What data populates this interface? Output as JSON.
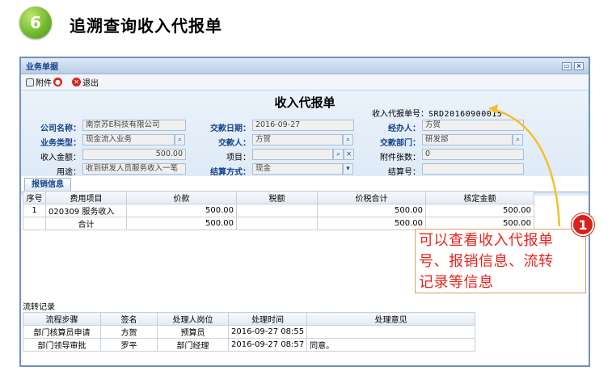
{
  "step": {
    "number": "6",
    "title": "追溯查询收入代报单"
  },
  "window": {
    "title": "业务单据"
  },
  "toolbar": {
    "attach": "附件",
    "exit": "退出"
  },
  "doc": {
    "title": "收入代报单",
    "no_label": "收入代报单号：",
    "no_value": "SRD20160900015"
  },
  "form": {
    "company_label": "公司名称：",
    "company_value": "南京苏E科技有限公司",
    "date_label": "交款日期：",
    "date_value": "2016-09-27",
    "handler_label": "经办人：",
    "handler_value": "方贺",
    "biztype_label": "业务类型：",
    "biztype_value": "现金流入业务",
    "payer_label": "交款人：",
    "payer_value": "方贺",
    "dept_label": "交款部门：",
    "dept_value": "研发部",
    "amount_label": "收入金额：",
    "amount_value": "500.00",
    "project_label": "项目：",
    "project_value": "",
    "attach_label": "附件张数：",
    "attach_value": "0",
    "purpose_label": "用途：",
    "purpose_value": "收到研发人员服务收入一笔",
    "settle_label": "结算方式：",
    "settle_value": "现金",
    "settleno_label": "结算号：",
    "settleno_value": ""
  },
  "tabs": {
    "expense": "报销信息"
  },
  "expense_table": {
    "headers": [
      "序号",
      "费用项目",
      "价款",
      "税额",
      "价税合计",
      "核定金额"
    ],
    "rows": [
      [
        "1",
        "020309 服务收入",
        "500.00",
        "",
        "500.00",
        "500.00"
      ]
    ],
    "total": {
      "label": "合计",
      "price": "500.00",
      "tax": "",
      "sum": "500.00",
      "approved": "500.00"
    }
  },
  "flow": {
    "label": "流转记录",
    "headers": [
      "流程步骤",
      "签名",
      "处理人岗位",
      "处理时间",
      "处理意见"
    ],
    "rows": [
      [
        "部门核算员申请",
        "方贺",
        "预算员",
        "2016-09-27 08:55",
        ""
      ],
      [
        "部门领导审批",
        "罗平",
        "部门经理",
        "2016-09-27 08:57",
        "同意。"
      ]
    ]
  },
  "callout": {
    "mark": "1",
    "line1": "可以查看收入代报单",
    "line2": "号、报销信息、流转",
    "line3": "记录等信息"
  }
}
